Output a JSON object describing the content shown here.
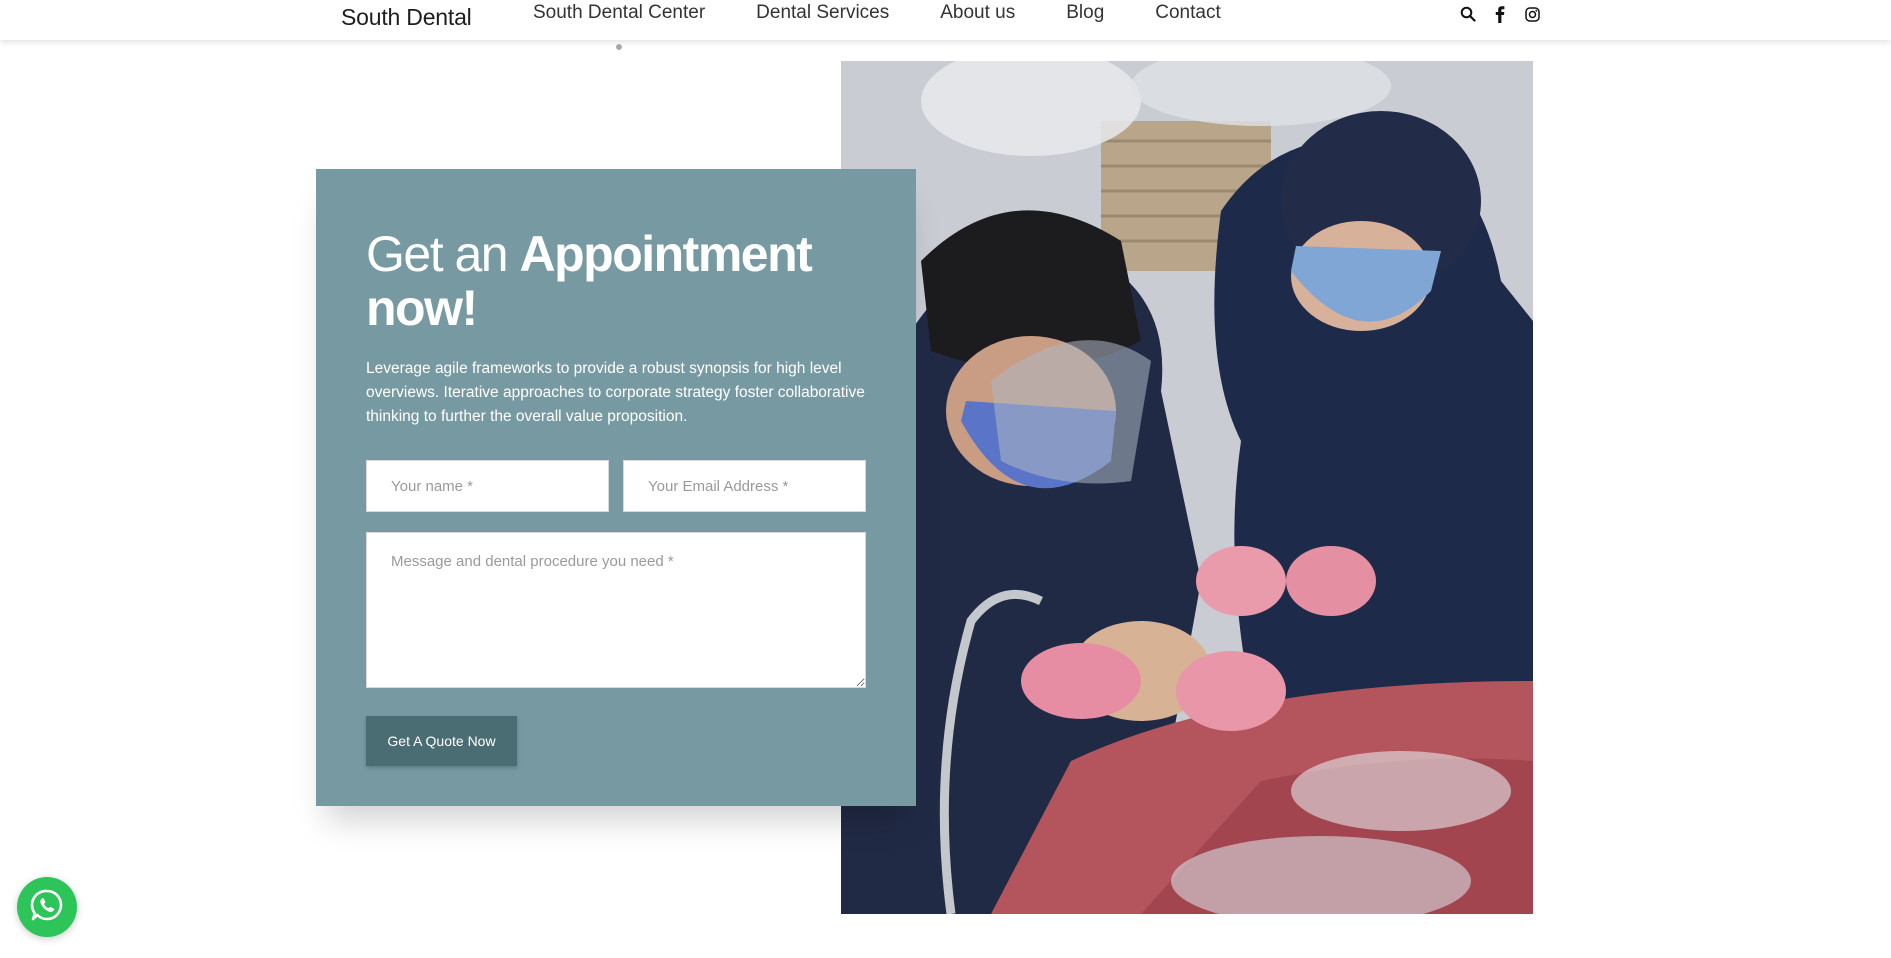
{
  "header": {
    "logo": "South Dental",
    "nav": [
      {
        "label": "South Dental Center",
        "active": true
      },
      {
        "label": "Dental Services"
      },
      {
        "label": "About us"
      },
      {
        "label": "Blog"
      },
      {
        "label": "Contact"
      }
    ],
    "icons": [
      "search-icon",
      "facebook-icon",
      "instagram-icon"
    ]
  },
  "appointment": {
    "heading_light": "Get an ",
    "heading_bold": "Appointment now!",
    "description": "Leverage agile frameworks to provide a robust synopsis for high level overviews. Iterative approaches to corporate strategy foster collaborative thinking to further the overall value proposition.",
    "name_placeholder": "Your name *",
    "email_placeholder": "Your Email Address *",
    "message_placeholder": "Message and dental procedure you need *",
    "button_label": "Get A Quote Now"
  },
  "photo": {
    "icon": "dental-procedure-photo"
  },
  "floating": {
    "icon": "whatsapp-icon"
  },
  "colors": {
    "panel": "#779aa2",
    "button": "#4a6d74",
    "whatsapp": "#2dc45a"
  }
}
